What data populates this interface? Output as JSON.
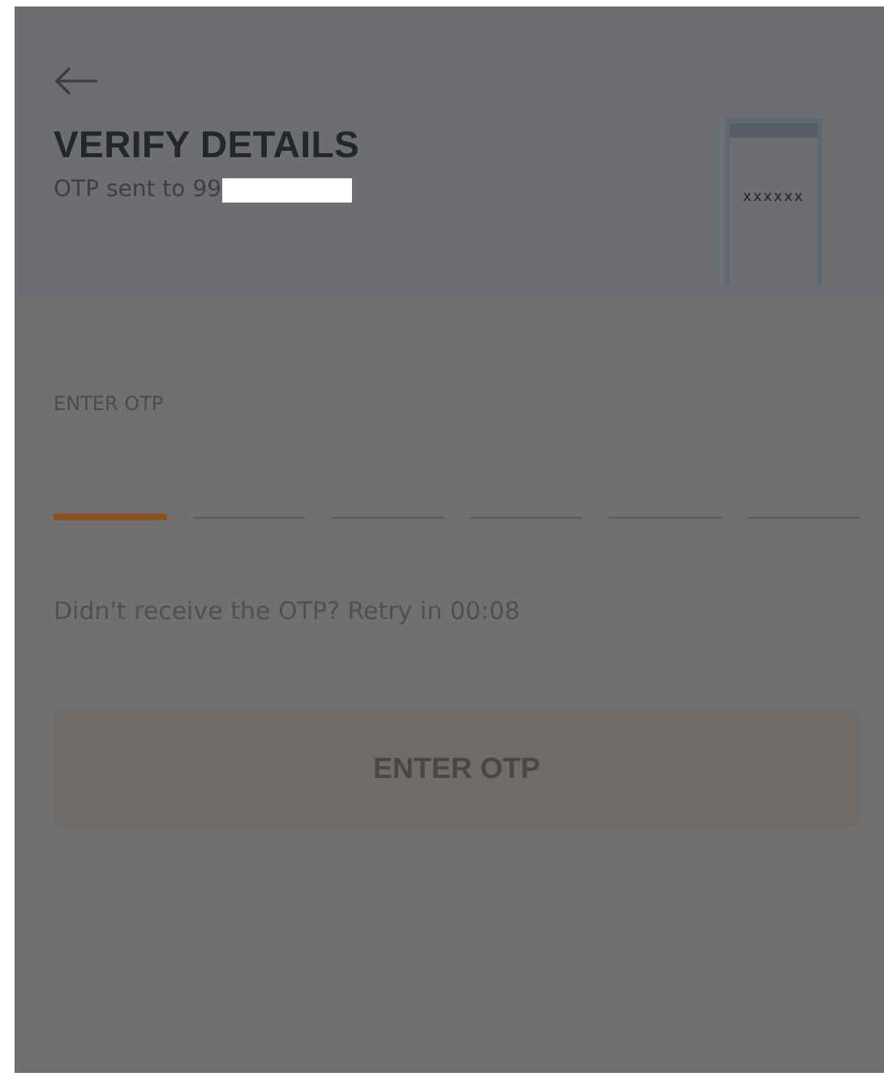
{
  "header": {
    "title": "VERIFY DETAILS",
    "subtitle": "OTP sent to 99",
    "redacted": true,
    "phone_text": "xxxxxx"
  },
  "otp": {
    "label": "ENTER OTP",
    "slots": [
      {
        "selected": true
      },
      {
        "selected": false
      },
      {
        "selected": false
      },
      {
        "selected": false
      },
      {
        "selected": false
      },
      {
        "selected": false
      }
    ]
  },
  "retry": "Didn't receive the OTP? Retry in 00:08",
  "button": {
    "label": "ENTER OTP",
    "disabled": true
  }
}
